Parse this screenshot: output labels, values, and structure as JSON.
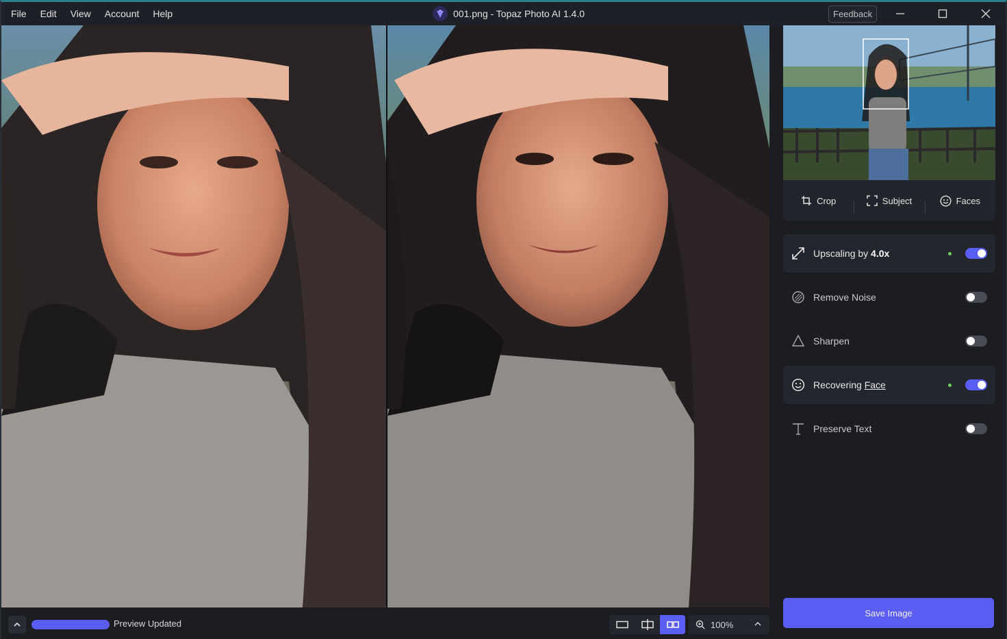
{
  "menu": [
    "File",
    "Edit",
    "View",
    "Account",
    "Help"
  ],
  "window_title": "001.png - Topaz Photo AI 1.4.0",
  "feedback_label": "Feedback",
  "thumbnail_actions": [
    {
      "label": "Crop",
      "icon": "crop-icon"
    },
    {
      "label": "Subject",
      "icon": "subject-icon"
    },
    {
      "label": "Faces",
      "icon": "faces-icon"
    }
  ],
  "tools": {
    "upscaling": {
      "prefix": "Upscaling by ",
      "value": "4.0x",
      "enabled": true,
      "active": true,
      "icon": "upscale-icon"
    },
    "remove_noise": {
      "label": "Remove Noise",
      "enabled": false,
      "icon": "noise-icon"
    },
    "sharpen": {
      "label": "Sharpen",
      "enabled": false,
      "icon": "sharpen-icon"
    },
    "recover_face": {
      "prefix": "Recovering ",
      "link": "Face",
      "enabled": true,
      "active": true,
      "icon": "face-icon"
    },
    "preserve_text": {
      "label": "Preserve Text",
      "enabled": false,
      "icon": "text-icon"
    }
  },
  "save_label": "Save Image",
  "status": {
    "text": "Preview Updated",
    "progress": 1.0
  },
  "zoom": {
    "label": "100%"
  },
  "colors": {
    "accent": "#5b5ef3",
    "active_dot": "#6fcf5b",
    "background": "#1b1d23"
  }
}
